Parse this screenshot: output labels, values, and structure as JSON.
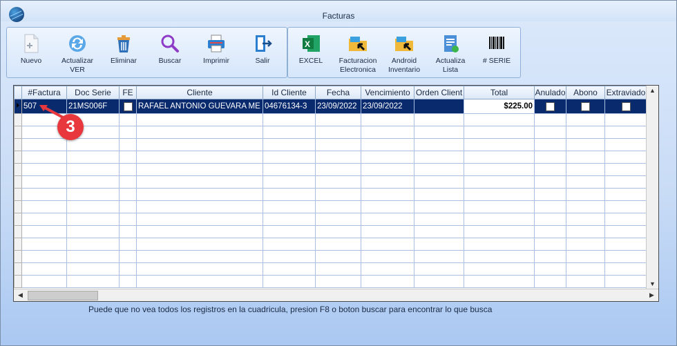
{
  "window": {
    "title": "Facturas"
  },
  "toolbar_left": [
    {
      "label1": "Nuevo",
      "label2": "",
      "icon": "new-document-icon"
    },
    {
      "label1": "Actualizar",
      "label2": "VER",
      "icon": "refresh-icon"
    },
    {
      "label1": "Eliminar",
      "label2": "",
      "icon": "trash-icon"
    },
    {
      "label1": "Buscar",
      "label2": "",
      "icon": "search-icon"
    },
    {
      "label1": "Imprimir",
      "label2": "",
      "icon": "printer-icon"
    },
    {
      "label1": "Salir",
      "label2": "",
      "icon": "exit-icon"
    }
  ],
  "toolbar_right": [
    {
      "label1": "EXCEL",
      "label2": "",
      "icon": "excel-icon"
    },
    {
      "label1": "Facturacion",
      "label2": "Electronica",
      "icon": "folder-arrow-icon"
    },
    {
      "label1": "Android",
      "label2": "Inventario",
      "icon": "folder-arrow-icon"
    },
    {
      "label1": "Actualiza",
      "label2": "Lista",
      "icon": "list-update-icon"
    },
    {
      "label1": "# SERIE",
      "label2": "",
      "icon": "barcode-icon"
    }
  ],
  "grid": {
    "columns": [
      "#Factura",
      "Doc Serie",
      "FE",
      "Cliente",
      "Id Cliente",
      "Fecha",
      "Vencimiento",
      "Orden Client",
      "Total",
      "Anulado",
      "Abono",
      "Extraviado"
    ],
    "rows": [
      {
        "factura": "507",
        "doc_serie": "21MS006F",
        "fe": false,
        "cliente": "RAFAEL ANTONIO GUEVARA ME",
        "id_cliente": "04676134-3",
        "fecha": "23/09/2022",
        "vencimiento": "23/09/2022",
        "orden": "",
        "total": "$225.00",
        "anulado": false,
        "abono": false,
        "extraviado": false
      }
    ]
  },
  "info_text": "Puede que no vea todos los registros en la cuadricula, presion F8 o boton buscar para encontrar lo que busca",
  "callout": "3",
  "colors": {
    "selection": "#0a2a6e",
    "callout": "#e8383d",
    "accent": "#1f5fb0"
  }
}
